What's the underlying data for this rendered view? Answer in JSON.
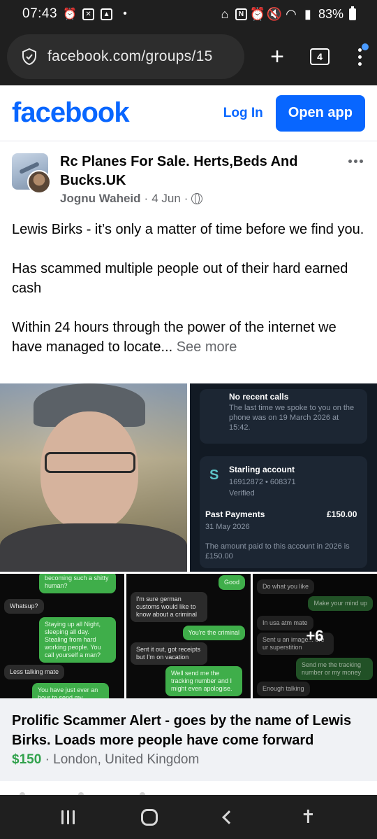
{
  "status_bar": {
    "time": "07:43",
    "battery": "83%"
  },
  "browser": {
    "url": "facebook.com/groups/15",
    "tab_count": "4"
  },
  "fb_header": {
    "logo": "facebook",
    "login_label": "Log In",
    "open_app_label": "Open app"
  },
  "post": {
    "group_name": "Rc Planes For Sale. Herts,Beds And Bucks.UK",
    "author": "Jognu Waheid",
    "date": "4 Jun",
    "text_p1": "Lewis Birks - it’s only a matter of time before we find you.",
    "text_p2": "Has scammed multiple people out of their hard earned cash",
    "text_p3": "Within 24 hours through the power of the internet we have managed to locate...",
    "see_more": "See more"
  },
  "photos": {
    "screenshot_calls": {
      "no_recent_calls": "No recent calls",
      "last_spoke": "The last time we spoke to you on the phone was on 19 March 2026 at 15:42.",
      "account_name": "Starling account",
      "account_number": "16912872 • 608371",
      "verified": "Verified",
      "past_payments": "Past Payments",
      "amount": "£150.00",
      "payment_date": "31 May 2026",
      "total_paid": "The amount paid to this account in 2026 is £150.00"
    },
    "chat1": {
      "m1": "becoming such a shitty human?",
      "m2": "Whatsup?",
      "m3": "Staying up all Night, sleeping all day. Stealing from hard working people. You call yourself a man?",
      "m4": "Less talking mate",
      "m5": "You have just ever an hour to send my money !!!"
    },
    "chat2": {
      "m1": "Good",
      "m2": "I'm sure german customs would like to know about a criminal",
      "m3": "You're the criminal",
      "m4": "Sent it out, got receipts but I'm on vacation",
      "m5": "Well send me the tracking number and I might even apologise."
    },
    "chat3": {
      "m1": "Do what you like",
      "m2": "Make your mind up",
      "m3": "In usa atm mate",
      "m4": "Sent u an image... ure ur superstition",
      "m5": "Send me the tracking number or my money",
      "m6": "Enough talking",
      "more_count": "+6"
    }
  },
  "listing": {
    "title": "Prolific Scammer Alert - goes by the name of Lewis Birks. Loads more people have come forward",
    "price": "$150",
    "location": "London, United Kingdom"
  }
}
